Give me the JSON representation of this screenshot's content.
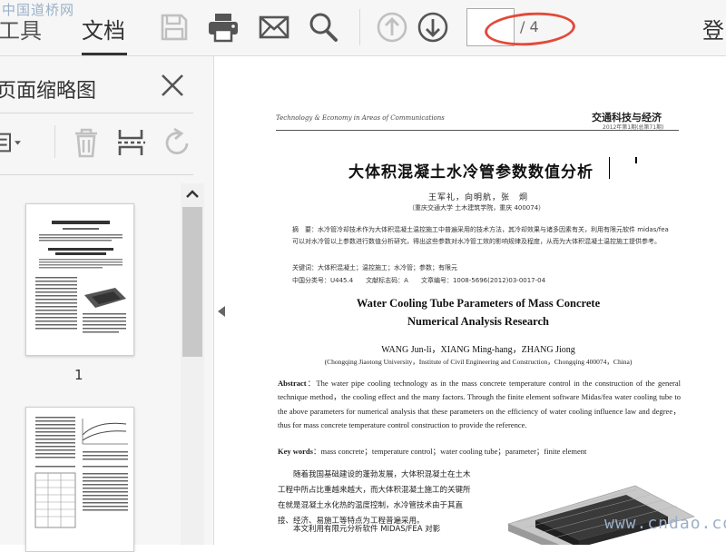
{
  "watermark_top": "中国道桥网",
  "watermark_bottom": "www.cndao.com",
  "toolbar": {
    "tabs": [
      "工具",
      "文档"
    ],
    "icons": [
      "save-icon",
      "print-icon",
      "mail-icon",
      "search-icon",
      "previous-page-icon",
      "next-page-icon"
    ],
    "page_input_value": "",
    "page_total": "/ 4",
    "login_label": "登"
  },
  "sidebar": {
    "title": "页面缩略图",
    "tools": [
      "page-options-icon",
      "delete-icon",
      "extract-icon",
      "rotate-icon"
    ],
    "thumbnails": [
      {
        "label": "1"
      },
      {
        "label": ""
      }
    ]
  },
  "document": {
    "header_left": "Technology & Economy in Areas of Communications",
    "header_right": "交通科技与经济",
    "header_right_sub": "2012年第1期(总第71期)",
    "cn_title": "大体积混凝土水冷管参数数值分析",
    "cn_authors": "王军礼，向明航，张　炯",
    "cn_affiliation": "（重庆交通大学 土木建筑学院，重庆 400074）",
    "cn_abstract": "摘　要：水冷管冷却技术作为大体积混凝土温控施工中普遍采用的技术方法，其冷却效果与诸多因素有关，利用有限元软件 midas/fea 可以对水冷管以上参数进行数值分析研究，得出这些参数对水冷管工效的影响规律及程度，从而为大体积混凝土温控施工提供参考。",
    "cn_keywords": "关键词：大体积混凝土；温控施工；水冷管；参数；有限元",
    "cn_classification": "中国分类号：U445.4　　文献标志码：A　　文章编号：1008-5696(2012)03-0017-04",
    "en_title_line1": "Water Cooling Tube Parameters of Mass Concrete",
    "en_title_line2": "Numerical Analysis Research",
    "en_authors": "WANG Jun-li，XIANG Ming-hang，ZHANG Jiong",
    "en_affiliation": "(Chongqing Jiaotong University，Institute of Civil Engineering and Construction，Chongqing 400074，China)",
    "en_abstract_label": "Abstract",
    "en_abstract": "：The water pipe cooling technology as in the mass concrete temperature control in the construction of the general technique method，the cooling effect and the many factors. Through the finite element software Midas/fea water cooling tube to the above parameters for numerical analysis that these parameters on the efficiency of water cooling influence law and degree，thus for mass concrete temperature control construction to provide the reference.",
    "en_keywords_label": "Key words",
    "en_keywords": "：mass concrete；temperature control；water cooling tube；parameter；finite element",
    "body_p1": "随着我国基础建设的蓬勃发展，大体积混凝土在土木工程中所占比重越来越大，而大体积混凝土施工的关键所在就是混凝土水化热的温度控制，水冷管技术由于其直接、经济、易施工等特点为工程普遍采用。",
    "body_p2": "本文利用有限元分析软件 MIDAS/FEA 对影"
  },
  "colors": {
    "toolbar_bg": "#f6f6f6",
    "annotation": "#e24a3a",
    "watermark": "#9ab0c8",
    "icon_dark": "#555555",
    "icon_disabled": "#c0c0c0"
  }
}
